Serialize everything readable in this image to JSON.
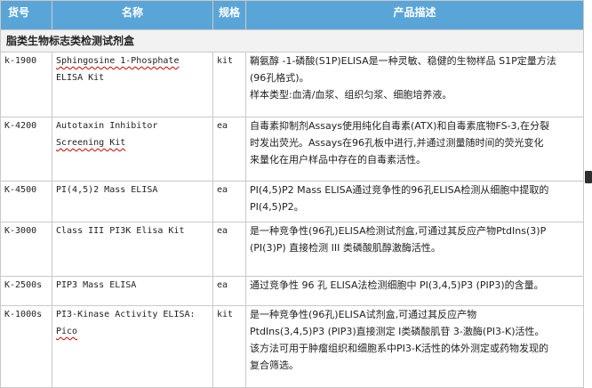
{
  "table": {
    "headers": {
      "sku": "货号",
      "name": "名称",
      "spec": "规格",
      "desc": "产品描述"
    },
    "section_title": "脂类生物标志类检测试剂盒",
    "rows": [
      {
        "sku": "k-1900",
        "name_line1": "Sphingosine 1-Phosphate",
        "name_line2": "ELISA Kit",
        "spec": "kit",
        "desc_line1": "鞘氨醇 -1-磷酸(S1P)ELISA是一种灵敏、稳健的生物样品 S1P定量方法",
        "desc_line2": "(96孔格式)。",
        "desc_line3": "样本类型:血清/血浆、组织匀浆、细胞培养液。",
        "desc_line4": ""
      },
      {
        "sku": "K-4200",
        "name_line1": "Autotaxin Inhibitor",
        "name_line2": "Screening Kit",
        "spec": "ea",
        "desc_line1": "自毒素抑制剂Assays使用纯化自毒素(ATX)和自毒素底物FS-3,在分裂",
        "desc_line2": "时发出荧光。Assays在96孔板中进行,并通过测量随时间的荧光变化",
        "desc_line3": "来量化在用户样品中存在的自毒素活性。",
        "desc_line4": ""
      },
      {
        "sku": "K-4500",
        "name_line1": "PI(4,5)2 Mass ELISA",
        "name_line2": "",
        "spec": "ea",
        "desc_line1": "PI(4,5)P2 Mass ELISA通过竞争性的96孔ELISA检测从细胞中提取的",
        "desc_line2": "PI(4,5)P2。",
        "desc_line3": "",
        "desc_line4": ""
      },
      {
        "sku": "K-3000",
        "name_line1": "Class III PI3K Elisa Kit",
        "name_line2": "",
        "spec": "ea",
        "desc_line1": "是一种竞争性(96孔)ELISA检测试剂盒,可通过其反应产物PtdIns(3)P",
        "desc_line2": "(PI(3)P) 直接检测 III 类磷酸肌醇激酶活性。",
        "desc_line3": "",
        "desc_line4": ""
      },
      {
        "sku": "K-2500s",
        "name_line1": "PIP3 Mass ELISA",
        "name_line2": "",
        "spec": "ea",
        "desc_line1": "通过竞争性 96 孔 ELISA法检测细胞中 PI(3,4,5)P3 (PIP3)的含量。",
        "desc_line2": "",
        "desc_line3": "",
        "desc_line4": ""
      },
      {
        "sku": "K-1000s",
        "name_line1": "PI3-Kinase Activity ELISA:",
        "name_line2": "Pico",
        "spec": "kit",
        "desc_line1": "是一种竞争性(96孔)ELISA试剂盒,可通过其反应产物",
        "desc_line2": "PtdIns(3,4,5)P3 (PIP3)直接测定 I类磷酸肌苷 3-激酶(PI3-K)活性。",
        "desc_line3": "该方法可用于肿瘤组织和细胞系中PI3-K活性的体外测定或药物发现的",
        "desc_line4": "复合筛选。"
      }
    ]
  }
}
